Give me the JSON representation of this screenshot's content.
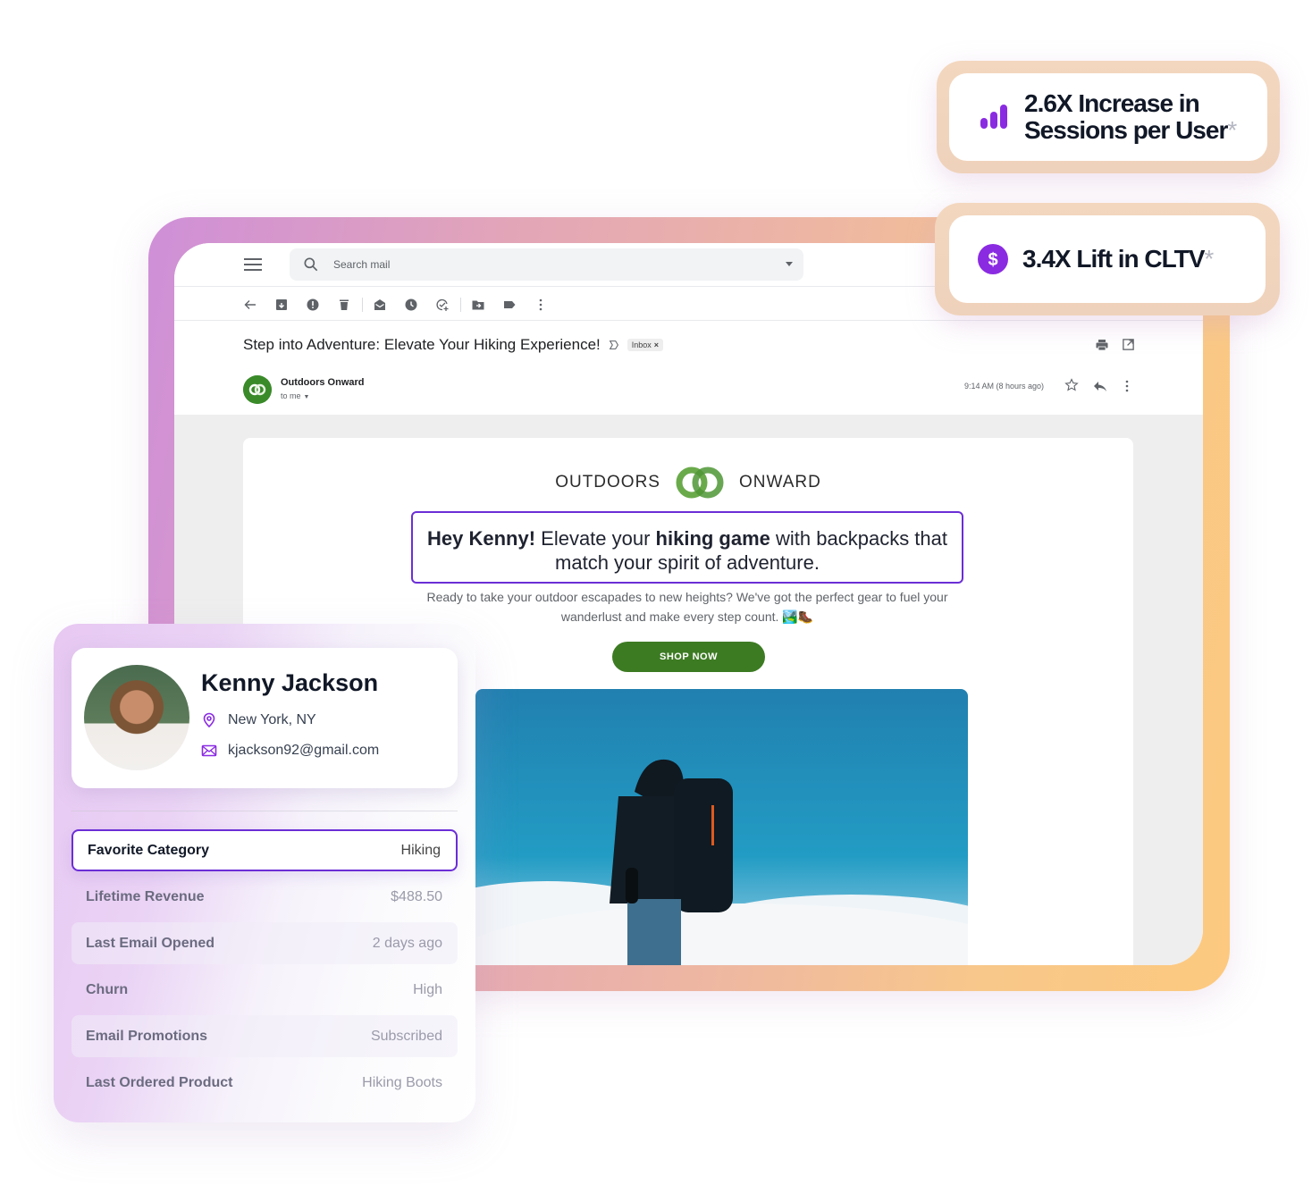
{
  "stats": [
    {
      "icon": "bar-chart-icon",
      "line1": "2.6X Increase in",
      "line2": "Sessions per User",
      "asterisk": "*"
    },
    {
      "icon": "dollar-circle-icon",
      "line1": "3.4X Lift in CLTV",
      "asterisk": "*"
    }
  ],
  "colors": {
    "accent_purple": "#6b2ed6",
    "brand_green": "#3d7b23",
    "icon_purple": "#8a2be2"
  },
  "mail": {
    "search": {
      "placeholder": "Search mail"
    },
    "toolbar": [
      "back",
      "archive",
      "report-spam",
      "delete",
      "mark-unread",
      "snooze",
      "add-task",
      "move-to",
      "labels",
      "more"
    ],
    "subject": "Step into Adventure: Elevate Your Hiking Experience!",
    "label_tag": "Inbox",
    "label_close": "×",
    "sender": {
      "name": "Outdoors Onward",
      "to": "to me"
    },
    "time": "9:14 AM (8 hours ago)",
    "email": {
      "brand_left": "OUTDOORS",
      "brand_right": "ONWARD",
      "headline": {
        "greeting": "Hey Kenny!",
        "part1": " Elevate your ",
        "emph": "hiking game",
        "part2": " with backpacks that match your spirit of adventure."
      },
      "intro": "Ready to take your outdoor escapades to new heights? We've got the perfect gear to fuel your wanderlust and make every step count. 🏞️🥾",
      "cta": "SHOP NOW"
    }
  },
  "profile": {
    "name": "Kenny Jackson",
    "location": "New York, NY",
    "email": "kjackson92@gmail.com",
    "attributes": [
      {
        "label": "Favorite Category",
        "value": "Hiking",
        "selected": true
      },
      {
        "label": "Lifetime Revenue",
        "value": "$488.50"
      },
      {
        "label": "Last Email Opened",
        "value": "2 days ago"
      },
      {
        "label": "Churn",
        "value": "High"
      },
      {
        "label": "Email Promotions",
        "value": "Subscribed"
      },
      {
        "label": "Last Ordered Product",
        "value": "Hiking Boots"
      }
    ]
  }
}
